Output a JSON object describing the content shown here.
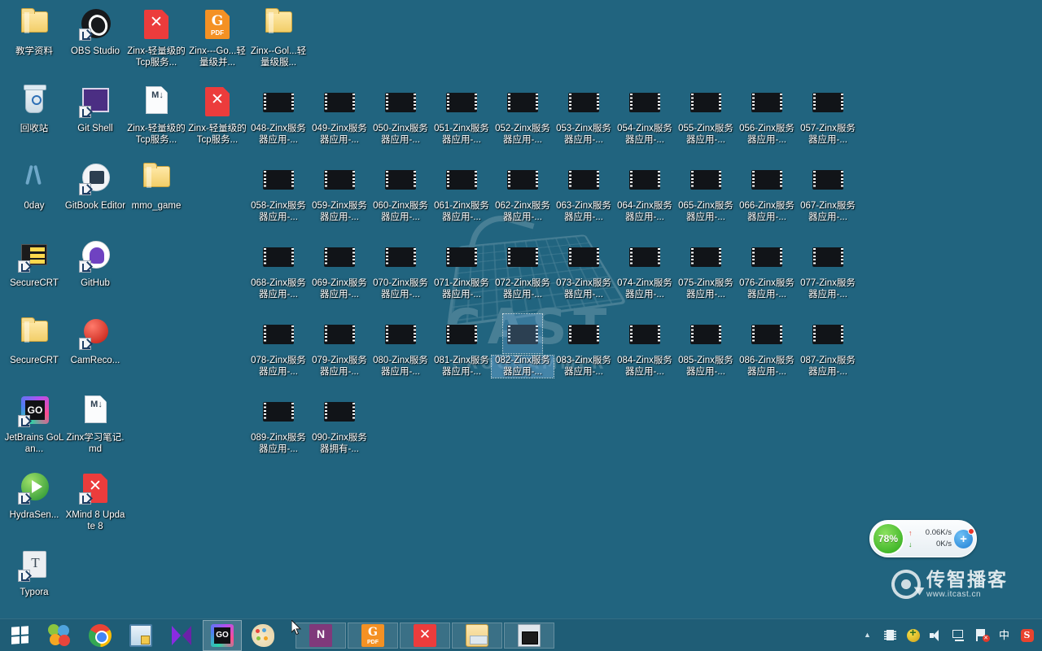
{
  "desktop": {
    "background_color": "#21647f",
    "watermark": {
      "big_text": "CAST",
      "sub_text": "PROGRAMMER"
    },
    "brand": {
      "name_cn": "传智播客",
      "url": "www.itcast.cn"
    }
  },
  "shortcuts": [
    {
      "label": "教学资料",
      "art": "art-folder",
      "shortcut": false,
      "col": 0,
      "row": 0
    },
    {
      "label": "OBS Studio",
      "art": "art-obs",
      "shortcut": true,
      "col": 1,
      "row": 0
    },
    {
      "label": "Zinx-轻量级的Tcp服务...",
      "art": "art-xmind",
      "shortcut": false,
      "col": 2,
      "row": 0
    },
    {
      "label": "Zinx---Go...轻量级并...",
      "art": "art-pdf",
      "shortcut": false,
      "col": 3,
      "row": 0
    },
    {
      "label": "Zinx--Gol...轻量级服...",
      "art": "art-folder",
      "shortcut": false,
      "col": 4,
      "row": 0
    },
    {
      "label": "回收站",
      "art": "art-recycle",
      "shortcut": false,
      "col": 0,
      "row": 1
    },
    {
      "label": "Git Shell",
      "art": "art-gitshell",
      "shortcut": true,
      "col": 1,
      "row": 1
    },
    {
      "label": "Zinx-轻量级的Tcp服务...",
      "art": "art-md",
      "shortcut": false,
      "col": 2,
      "row": 1
    },
    {
      "label": "Zinx-轻量级的Tcp服务...",
      "art": "art-xmind",
      "shortcut": false,
      "col": 3,
      "row": 1
    },
    {
      "label": "0day",
      "art": "art-scissors",
      "shortcut": false,
      "col": 0,
      "row": 2
    },
    {
      "label": "GitBook Editor",
      "art": "art-gitbook",
      "shortcut": true,
      "col": 1,
      "row": 2
    },
    {
      "label": "mmo_game",
      "art": "art-folder",
      "shortcut": false,
      "col": 2,
      "row": 2
    },
    {
      "label": "SecureCRT",
      "art": "art-securecrt",
      "shortcut": true,
      "col": 0,
      "row": 3
    },
    {
      "label": "GitHub",
      "art": "art-github",
      "shortcut": true,
      "col": 1,
      "row": 3
    },
    {
      "label": "SecureCRT",
      "art": "art-folder",
      "shortcut": false,
      "col": 0,
      "row": 4
    },
    {
      "label": "CamReco...",
      "art": "art-camrec",
      "shortcut": true,
      "col": 1,
      "row": 4
    },
    {
      "label": "JetBrains GoLan...",
      "art": "art-goland",
      "shortcut": true,
      "col": 0,
      "row": 5
    },
    {
      "label": "Zinx学习笔记.md",
      "art": "art-md",
      "shortcut": false,
      "col": 1,
      "row": 5
    },
    {
      "label": "HydraSen...",
      "art": "art-hydra",
      "shortcut": true,
      "col": 0,
      "row": 6
    },
    {
      "label": "XMind 8 Update 8",
      "art": "art-xmind",
      "shortcut": true,
      "col": 1,
      "row": 6
    },
    {
      "label": "Typora",
      "art": "art-typora",
      "shortcut": true,
      "col": 0,
      "row": 7
    }
  ],
  "videos": {
    "suffix": "-Zinx服务器应用-...",
    "items": [
      {
        "label": "048-Zinx服务器应用-...",
        "col": 4,
        "row": 1
      },
      {
        "label": "049-Zinx服务器应用-...",
        "col": 5,
        "row": 1
      },
      {
        "label": "050-Zinx服务器应用-...",
        "col": 6,
        "row": 1
      },
      {
        "label": "051-Zinx服务器应用-...",
        "col": 7,
        "row": 1
      },
      {
        "label": "052-Zinx服务器应用-...",
        "col": 8,
        "row": 1
      },
      {
        "label": "053-Zinx服务器应用-...",
        "col": 9,
        "row": 1
      },
      {
        "label": "054-Zinx服务器应用-...",
        "col": 10,
        "row": 1
      },
      {
        "label": "055-Zinx服务器应用-...",
        "col": 11,
        "row": 1
      },
      {
        "label": "056-Zinx服务器应用-...",
        "col": 12,
        "row": 1
      },
      {
        "label": "057-Zinx服务器应用-...",
        "col": 13,
        "row": 1
      },
      {
        "label": "058-Zinx服务器应用-...",
        "col": 4,
        "row": 2
      },
      {
        "label": "059-Zinx服务器应用-...",
        "col": 5,
        "row": 2
      },
      {
        "label": "060-Zinx服务器应用-...",
        "col": 6,
        "row": 2
      },
      {
        "label": "061-Zinx服务器应用-...",
        "col": 7,
        "row": 2
      },
      {
        "label": "062-Zinx服务器应用-...",
        "col": 8,
        "row": 2
      },
      {
        "label": "063-Zinx服务器应用-...",
        "col": 9,
        "row": 2
      },
      {
        "label": "064-Zinx服务器应用-...",
        "col": 10,
        "row": 2
      },
      {
        "label": "065-Zinx服务器应用-...",
        "col": 11,
        "row": 2
      },
      {
        "label": "066-Zinx服务器应用-...",
        "col": 12,
        "row": 2
      },
      {
        "label": "067-Zinx服务器应用-...",
        "col": 13,
        "row": 2
      },
      {
        "label": "068-Zinx服务器应用-...",
        "col": 4,
        "row": 3
      },
      {
        "label": "069-Zinx服务器应用-...",
        "col": 5,
        "row": 3
      },
      {
        "label": "070-Zinx服务器应用-...",
        "col": 6,
        "row": 3
      },
      {
        "label": "071-Zinx服务器应用-...",
        "col": 7,
        "row": 3
      },
      {
        "label": "072-Zinx服务器应用-...",
        "col": 8,
        "row": 3
      },
      {
        "label": "073-Zinx服务器应用-...",
        "col": 9,
        "row": 3
      },
      {
        "label": "074-Zinx服务器应用-...",
        "col": 10,
        "row": 3
      },
      {
        "label": "075-Zinx服务器应用-...",
        "col": 11,
        "row": 3
      },
      {
        "label": "076-Zinx服务器应用-...",
        "col": 12,
        "row": 3
      },
      {
        "label": "077-Zinx服务器应用-...",
        "col": 13,
        "row": 3
      },
      {
        "label": "078-Zinx服务器应用-...",
        "col": 4,
        "row": 4
      },
      {
        "label": "079-Zinx服务器应用-...",
        "col": 5,
        "row": 4
      },
      {
        "label": "080-Zinx服务器应用-...",
        "col": 6,
        "row": 4
      },
      {
        "label": "081-Zinx服务器应用-...",
        "col": 7,
        "row": 4
      },
      {
        "label": "082-Zinx服务器应用-...",
        "col": 8,
        "row": 4,
        "selected": true
      },
      {
        "label": "083-Zinx服务器应用-...",
        "col": 9,
        "row": 4
      },
      {
        "label": "084-Zinx服务器应用-...",
        "col": 10,
        "row": 4
      },
      {
        "label": "085-Zinx服务器应用-...",
        "col": 11,
        "row": 4
      },
      {
        "label": "086-Zinx服务器应用-...",
        "col": 12,
        "row": 4
      },
      {
        "label": "087-Zinx服务器应用-...",
        "col": 13,
        "row": 4
      },
      {
        "label": "089-Zinx服务器应用-...",
        "col": 4,
        "row": 5
      },
      {
        "label": "090-Zinx服务器拥有-...",
        "col": 5,
        "row": 5
      }
    ]
  },
  "net_widget": {
    "cpu_percent": "78%",
    "upload": "0.06K/s",
    "download": "0K/s",
    "upload_arrow": "↑",
    "download_arrow": "↓",
    "plus_label": "+"
  },
  "taskbar": {
    "start_label": "Start",
    "pinned": [
      {
        "name": "taskbar-item-ball",
        "icon": "ti-ball"
      },
      {
        "name": "taskbar-item-chrome",
        "icon": "ti-chrome"
      },
      {
        "name": "taskbar-item-remote-desktop",
        "icon": "ti-rdp"
      },
      {
        "name": "taskbar-item-visual-studio",
        "icon": "ti-vs"
      },
      {
        "name": "taskbar-item-goland",
        "icon": "ti-go",
        "active": true
      },
      {
        "name": "taskbar-item-paint",
        "icon": "ti-paint"
      }
    ],
    "windows": [
      {
        "name": "taskbar-window-onenote",
        "icon": "ti-onenote"
      },
      {
        "name": "taskbar-window-foxit-pdf",
        "icon": "ti-pdf",
        "g": "G",
        "t": "PDF"
      },
      {
        "name": "taskbar-window-xmind",
        "icon": "ti-xmind"
      },
      {
        "name": "taskbar-window-file-explorer",
        "icon": "ti-explorer"
      },
      {
        "name": "taskbar-window-securecrt",
        "icon": "ti-crt"
      }
    ],
    "tray": {
      "chevron": "▲",
      "ime": "中",
      "sogou": "S",
      "network_badge": "✕"
    }
  }
}
